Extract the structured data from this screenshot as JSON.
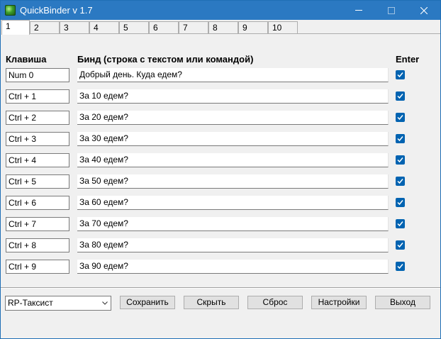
{
  "window": {
    "title": "QuickBinder v 1.7"
  },
  "tabs": [
    "1",
    "2",
    "3",
    "4",
    "5",
    "6",
    "7",
    "8",
    "9",
    "10"
  ],
  "headers": {
    "key": "Клавиша",
    "bind": "Бинд (строка с текстом или командой)",
    "enter": "Enter"
  },
  "rows": [
    {
      "key": "Num 0",
      "bind": "Добрый день. Куда едем?",
      "enter": true
    },
    {
      "key": "Ctrl + 1",
      "bind": "За 10 едем?",
      "enter": true
    },
    {
      "key": "Ctrl + 2",
      "bind": "За 20 едем?",
      "enter": true
    },
    {
      "key": "Ctrl + 3",
      "bind": "За 30 едем?",
      "enter": true
    },
    {
      "key": "Ctrl + 4",
      "bind": "За 40 едем?",
      "enter": true
    },
    {
      "key": "Ctrl + 5",
      "bind": "За 50 едем?",
      "enter": true
    },
    {
      "key": "Ctrl + 6",
      "bind": "За 60 едем?",
      "enter": true
    },
    {
      "key": "Ctrl + 7",
      "bind": "За 70 едем?",
      "enter": true
    },
    {
      "key": "Ctrl + 8",
      "bind": "За 80 едем?",
      "enter": true
    },
    {
      "key": "Ctrl + 9",
      "bind": "За 90 едем?",
      "enter": true
    }
  ],
  "footer": {
    "profile": "RP-Таксист",
    "save": "Сохранить",
    "hide": "Скрыть",
    "reset": "Сброс",
    "settings": "Настройки",
    "exit": "Выход"
  },
  "colors": {
    "titlebar": "#2b79c2",
    "checkbox": "#0063b1"
  }
}
